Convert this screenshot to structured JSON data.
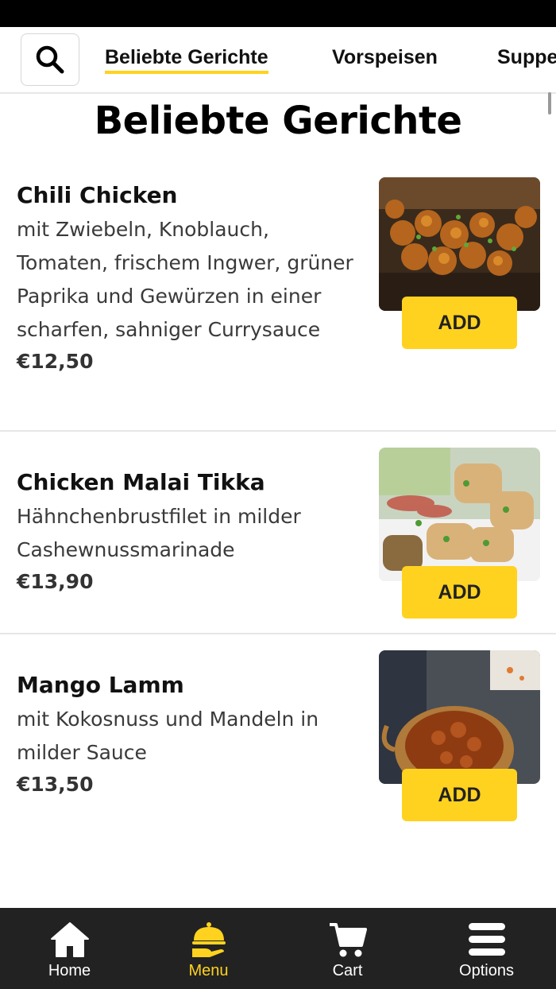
{
  "colors": {
    "accent": "#ffd21f",
    "nav_bg": "#222222",
    "status_bar": "#000000"
  },
  "categories": [
    {
      "label": "Beliebte Gerichte",
      "active": true
    },
    {
      "label": "Vorspeisen",
      "active": false
    },
    {
      "label": "Suppen",
      "active": false
    }
  ],
  "section_title": "Beliebte Gerichte",
  "dishes": [
    {
      "name": "Chili Chicken",
      "description": "mit Zwiebeln, Knoblauch, Tomaten, frischem Ingwer, grüner Paprika und Gewürzen in einer scharfen, sahniger Currysauce",
      "price": "€12,50",
      "add_label": "ADD"
    },
    {
      "name": "Chicken Malai Tikka",
      "description": "Hähnchenbrustfilet in milder Cashewnussmarinade",
      "price": "€13,90",
      "add_label": "ADD"
    },
    {
      "name": "Mango Lamm",
      "description": "mit Kokosnuss und Mandeln in milder Sauce",
      "price": "€13,50",
      "add_label": "ADD"
    }
  ],
  "bottom_nav": [
    {
      "label": "Home",
      "icon": "home-icon",
      "active": false
    },
    {
      "label": "Menu",
      "icon": "cloche-icon",
      "active": true
    },
    {
      "label": "Cart",
      "icon": "cart-icon",
      "active": false
    },
    {
      "label": "Options",
      "icon": "menu-icon",
      "active": false
    }
  ]
}
